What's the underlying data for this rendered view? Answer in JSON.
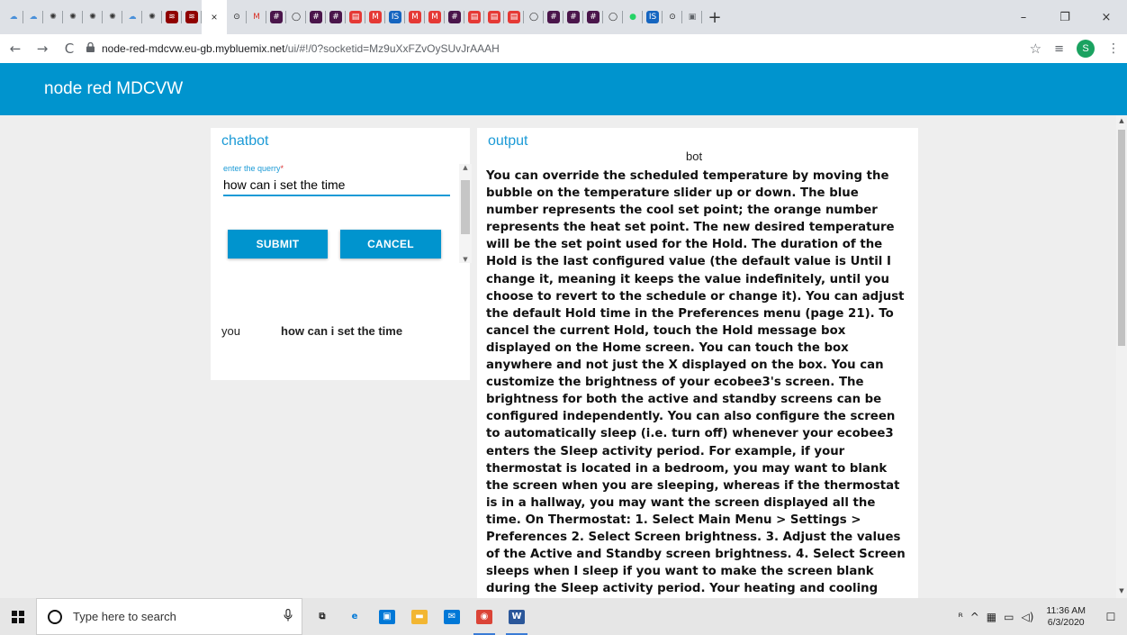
{
  "browser": {
    "tabs": [
      {
        "icon": "cloud-tab-icon",
        "glyph": "☁",
        "bg": "#dee1e6",
        "fg": "#4a90d9"
      },
      {
        "icon": "cloud-tab-icon",
        "glyph": "☁",
        "bg": "#dee1e6",
        "fg": "#4a90d9"
      },
      {
        "icon": "watson-tab-icon",
        "glyph": "✺",
        "bg": "#dee1e6",
        "fg": "#333"
      },
      {
        "icon": "watson-tab-icon",
        "glyph": "✺",
        "bg": "#dee1e6",
        "fg": "#333"
      },
      {
        "icon": "watson-tab-icon",
        "glyph": "✺",
        "bg": "#dee1e6",
        "fg": "#333"
      },
      {
        "icon": "watson-tab-icon",
        "glyph": "✺",
        "bg": "#dee1e6",
        "fg": "#333"
      },
      {
        "icon": "cloud-tab-icon",
        "glyph": "☁",
        "bg": "#dee1e6",
        "fg": "#4a90d9"
      },
      {
        "icon": "watson-tab-icon",
        "glyph": "✺",
        "bg": "#dee1e6",
        "fg": "#333"
      },
      {
        "icon": "node-red-tab-icon",
        "glyph": "≋",
        "bg": "#8f0000",
        "fg": "#fff"
      },
      {
        "icon": "node-red-tab-icon",
        "glyph": "≋",
        "bg": "#8f0000",
        "fg": "#fff"
      }
    ],
    "active_tab_close": "×",
    "tabs_after": [
      {
        "icon": "github-tab-icon",
        "glyph": "⊙",
        "bg": "#dee1e6",
        "fg": "#222"
      },
      {
        "icon": "gmail-tab-icon",
        "glyph": "M",
        "bg": "#dee1e6",
        "fg": "#d93025"
      },
      {
        "icon": "slack-tab-icon",
        "glyph": "#",
        "bg": "#4a154b",
        "fg": "#fff"
      },
      {
        "icon": "github-tab-icon",
        "glyph": "◯",
        "bg": "#dee1e6",
        "fg": "#222"
      },
      {
        "icon": "slack-tab-icon",
        "glyph": "#",
        "bg": "#4a154b",
        "fg": "#fff"
      },
      {
        "icon": "slack-tab-icon",
        "glyph": "#",
        "bg": "#4a154b",
        "fg": "#fff"
      },
      {
        "icon": "calendar-tab-icon",
        "glyph": "▤",
        "bg": "#e53935",
        "fg": "#fff"
      },
      {
        "icon": "medium-tab-icon",
        "glyph": "M",
        "bg": "#e53935",
        "fg": "#fff"
      },
      {
        "icon": "is-tab-icon",
        "glyph": "IS",
        "bg": "#1565c0",
        "fg": "#fff"
      },
      {
        "icon": "medium-tab-icon",
        "glyph": "M",
        "bg": "#e53935",
        "fg": "#fff"
      },
      {
        "icon": "medium-tab-icon",
        "glyph": "M",
        "bg": "#e53935",
        "fg": "#fff"
      },
      {
        "icon": "slack-tab-icon",
        "glyph": "#",
        "bg": "#4a154b",
        "fg": "#fff"
      },
      {
        "icon": "calendar-tab-icon",
        "glyph": "▤",
        "bg": "#e53935",
        "fg": "#fff"
      },
      {
        "icon": "calendar-tab-icon",
        "glyph": "▤",
        "bg": "#e53935",
        "fg": "#fff"
      },
      {
        "icon": "calendar-tab-icon",
        "glyph": "▤",
        "bg": "#e53935",
        "fg": "#fff"
      },
      {
        "icon": "github-tab-icon",
        "glyph": "◯",
        "bg": "#dee1e6",
        "fg": "#222"
      },
      {
        "icon": "slack-tab-icon",
        "glyph": "#",
        "bg": "#4a154b",
        "fg": "#fff"
      },
      {
        "icon": "slack-tab-icon",
        "glyph": "#",
        "bg": "#4a154b",
        "fg": "#fff"
      },
      {
        "icon": "slack-tab-icon",
        "glyph": "#",
        "bg": "#4a154b",
        "fg": "#fff"
      },
      {
        "icon": "github-tab-icon",
        "glyph": "◯",
        "bg": "#dee1e6",
        "fg": "#222"
      },
      {
        "icon": "whatsapp-tab-icon",
        "glyph": "●",
        "bg": "#dee1e6",
        "fg": "#25d366"
      },
      {
        "icon": "is-tab-icon",
        "glyph": "IS",
        "bg": "#1565c0",
        "fg": "#fff"
      },
      {
        "icon": "github-tab-icon",
        "glyph": "⊙",
        "bg": "#dee1e6",
        "fg": "#222"
      },
      {
        "icon": "doc-tab-icon",
        "glyph": "▣",
        "bg": "#dee1e6",
        "fg": "#5f6368"
      }
    ],
    "new_tab": "+",
    "window_controls": {
      "minimize": "–",
      "maximize": "❐",
      "close": "×"
    },
    "nav": {
      "back": "←",
      "forward": "→",
      "reload": "C"
    },
    "url": {
      "host": "node-red-mdcvw.eu-gb.mybluemix.net",
      "path": "/ui/#!/0?socketid=Mz9uXxFZvOySUvJrAAAH"
    },
    "lock_glyph": "🔒",
    "star_glyph": "☆",
    "queue_glyph": "≡",
    "profile_initial": "S",
    "menu_glyph": "⋮"
  },
  "app": {
    "title": "node red MDCVW",
    "accent": "#0094ce"
  },
  "chatbot": {
    "title": "chatbot",
    "input_label": "enter the querry",
    "required_mark": "*",
    "input_value": "how can i set the time",
    "submit_label": "SUBMIT",
    "cancel_label": "CANCEL",
    "you_label": "you",
    "you_message": "how can i set the time"
  },
  "output": {
    "title": "output",
    "bot_label": "bot",
    "text": "You can override the scheduled temperature by moving the bubble on the temperature slider up or down. The blue number represents the cool set point; the orange number represents the heat set point. The new desired temperature will be the set point used for the Hold. The duration of the Hold is the last configured value (the default value is Until I change it, meaning it keeps the value indefinitely, until you choose to revert to the schedule or change it). You can adjust the default Hold time in the Preferences menu (page 21). To cancel the current Hold, touch the Hold message box displayed on the Home screen. You can touch the box anywhere and not just the X displayed on the box. You can customize the brightness of your ecobee3's screen. The brightness for both the active and standby screens can be configured independently. You can also configure the screen to automatically sleep (i.e. turn off) whenever your ecobee3 enters the Sleep activity period. For example, if your thermostat is located in a bedroom, you may want to blank the screen when you are sleeping, whereas if the thermostat is in a hallway, you may want the screen displayed all the time. On Thermostat: 1. Select Main Menu > Settings > Preferences 2. Select Screen brightness. 3. Adjust the values of the Active and Standby screen brightness. 4. Select Screen sleeps when I sleep if you want to make the screen blank during the Sleep activity period. Your heating and cooling needs change depending on the time of day, day of the week, as well as when you are home or away. For example, if there's no one in the house during the weekday, you can set the temperature to save energy and a schedule"
  },
  "taskbar": {
    "search_placeholder": "Type here to search",
    "mic_glyph": "🎙",
    "apps": [
      {
        "name": "task-view-icon",
        "glyph": "⧉",
        "bg": "#e6e6e6",
        "fg": "#222"
      },
      {
        "name": "edge-icon",
        "glyph": "e",
        "bg": "#e6e6e6",
        "fg": "#0078d7"
      },
      {
        "name": "store-icon",
        "glyph": "▣",
        "bg": "#0078d7",
        "fg": "#fff"
      },
      {
        "name": "file-explorer-icon",
        "glyph": "▬",
        "bg": "#f2b632",
        "fg": "#fff"
      },
      {
        "name": "mail-icon",
        "glyph": "✉",
        "bg": "#0078d7",
        "fg": "#fff"
      },
      {
        "name": "chrome-icon",
        "glyph": "◉",
        "bg": "#db4437",
        "fg": "#fff",
        "active": true
      },
      {
        "name": "word-icon",
        "glyph": "W",
        "bg": "#2b579a",
        "fg": "#fff",
        "active": true
      }
    ],
    "tray": {
      "people": "ᴿ",
      "chevron": "^",
      "language": "▦",
      "battery": "▭",
      "volume": "◁)"
    },
    "time": "11:36 AM",
    "date": "6/3/2020",
    "notification_glyph": "☐"
  }
}
